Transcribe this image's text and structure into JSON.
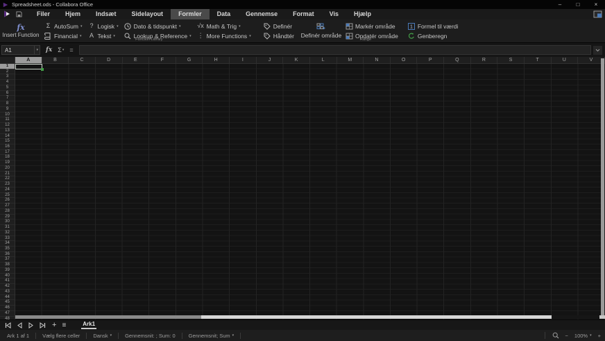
{
  "window": {
    "title": "Spreadsheet.ods - Collabora Office",
    "controls": {
      "minimize": "–",
      "maximize": "□",
      "close": "×"
    }
  },
  "menu": {
    "items": [
      {
        "label": "Filer",
        "active": false
      },
      {
        "label": "Hjem",
        "active": false
      },
      {
        "label": "Indsæt",
        "active": false
      },
      {
        "label": "Sidelayout",
        "active": false
      },
      {
        "label": "Formler",
        "active": true
      },
      {
        "label": "Data",
        "active": false
      },
      {
        "label": "Gennemse",
        "active": false
      },
      {
        "label": "Format",
        "active": false
      },
      {
        "label": "Vis",
        "active": false
      },
      {
        "label": "Hjælp",
        "active": false
      }
    ]
  },
  "ribbon": {
    "insert_function_label": "Insert Function",
    "autosum": "AutoSum",
    "logisk": "Logisk",
    "dato": "Dato & tidspunkt",
    "math": "Math & Trig",
    "financial": "Financial",
    "tekst": "Tekst",
    "lookup": "Lookup & Reference",
    "more": "More Functions",
    "function_library_label": "Function Library",
    "definer": "Definér",
    "haandter": "Håndtér",
    "definer_omraade": "Definér område",
    "marker_omraade": "Markér område",
    "opdater_omraade": "Opdatér område",
    "range_label": "Range",
    "formel_til_vaerdi": "Formel til værdi",
    "genberegn": "Genberegn"
  },
  "icons": {
    "fx": "fx",
    "sigma": "Σ",
    "question": "?",
    "sqrt": "√x",
    "letter_a": "A",
    "ellipsis": "⋮",
    "equals": "=",
    "caret": "▾",
    "one": "1",
    "plus": "+",
    "minus": "−",
    "hamburger": "≡"
  },
  "formula_bar": {
    "cell_ref": "A1",
    "formula_value": ""
  },
  "grid": {
    "columns": [
      "A",
      "B",
      "C",
      "D",
      "E",
      "F",
      "G",
      "H",
      "I",
      "J",
      "K",
      "L",
      "M",
      "N",
      "O",
      "P",
      "Q",
      "R",
      "S",
      "T",
      "U",
      "V"
    ],
    "rows": [
      1,
      2,
      3,
      4,
      5,
      6,
      7,
      8,
      9,
      10,
      11,
      12,
      13,
      14,
      15,
      16,
      17,
      18,
      19,
      20,
      21,
      22,
      23,
      24,
      25,
      26,
      27,
      28,
      29,
      30,
      31,
      32,
      33,
      34,
      35,
      36,
      37,
      38,
      39,
      40,
      41,
      42,
      43,
      44,
      45,
      46,
      47,
      48
    ],
    "selected_cell": "A1"
  },
  "sheet_nav": {
    "tabs": [
      {
        "label": "Ark1",
        "active": true
      }
    ]
  },
  "status_bar": {
    "sheet_info": "Ark 1 af 1",
    "selection_mode": "Vælg flere celler",
    "language": "Dansk",
    "stats": "Gennemsnit: ; Sum: 0",
    "stats_selector": "Gennemsnit; Sum",
    "zoom_level": "100%"
  },
  "colors": {
    "accent_blue": "#4a7ab8",
    "accent_green": "#43a047",
    "logo_purple": "#5a2d82",
    "selection_border": "#ccd5cc"
  }
}
